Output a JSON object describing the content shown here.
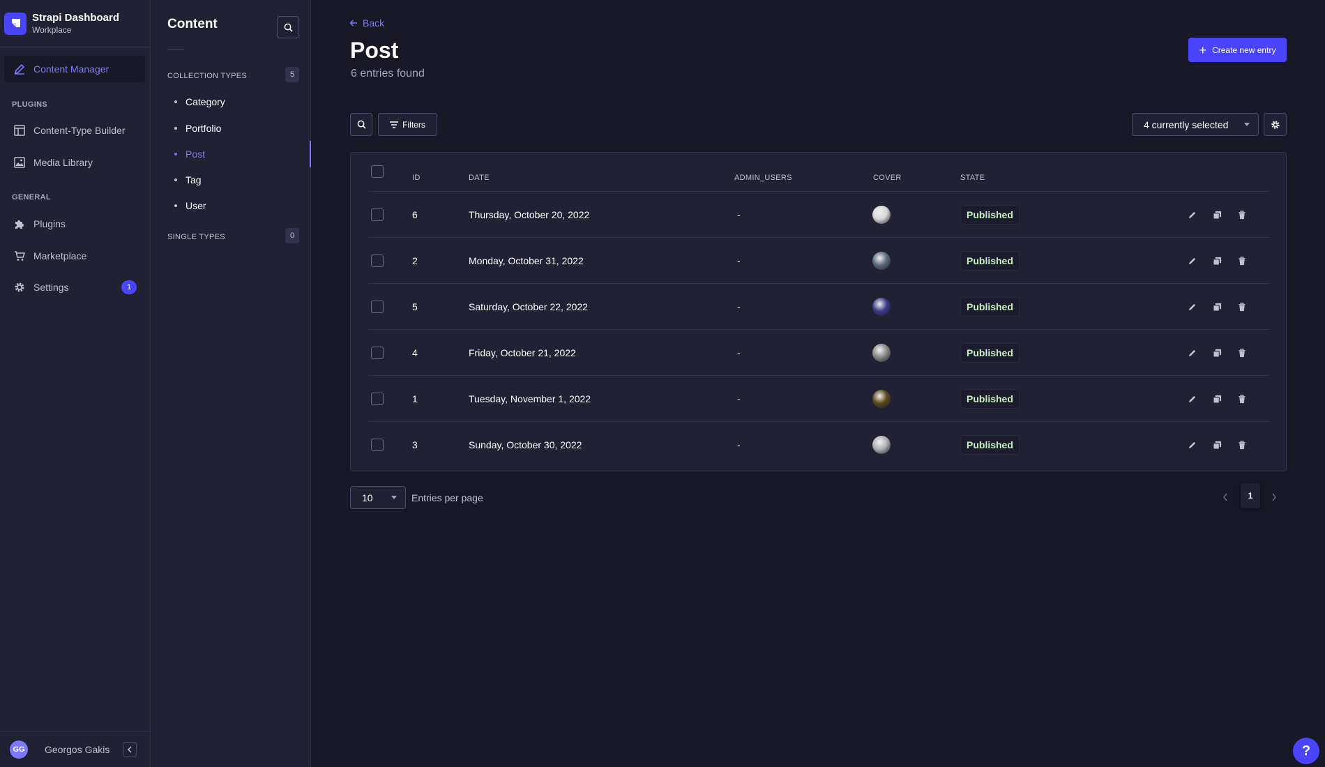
{
  "brand": {
    "title": "Strapi Dashboard",
    "subtitle": "Workplace"
  },
  "mainnav": {
    "content_manager": "Content Manager",
    "plugins_section": "PLUGINS",
    "content_type_builder": "Content-Type Builder",
    "media_library": "Media Library",
    "general_section": "GENERAL",
    "plugins": "Plugins",
    "marketplace": "Marketplace",
    "settings": "Settings",
    "settings_badge": "1"
  },
  "user": {
    "initials": "GG",
    "name": "Georgos Gakis"
  },
  "subnav": {
    "title": "Content",
    "collection_types_label": "COLLECTION TYPES",
    "collection_types_count": "5",
    "collection_types": [
      "Category",
      "Portfolio",
      "Post",
      "Tag",
      "User"
    ],
    "active_item": "Post",
    "single_types_label": "SINGLE TYPES",
    "single_types_count": "0"
  },
  "header": {
    "back_label": "Back",
    "title": "Post",
    "subtitle": "6 entries found",
    "create_label": "Create new entry"
  },
  "toolbar": {
    "filters_label": "Filters",
    "columns_selected": "4 currently selected"
  },
  "table": {
    "headers": {
      "id": "ID",
      "date": "DATE",
      "admin_users": "ADMIN_USERS",
      "cover": "COVER",
      "state": "STATE"
    },
    "rows": [
      {
        "id": "6",
        "date": "Thursday, October 20, 2022",
        "admin_users": "-",
        "state": "Published",
        "cover_color": "#d7d7d7"
      },
      {
        "id": "2",
        "date": "Monday, October 31, 2022",
        "admin_users": "-",
        "state": "Published",
        "cover_color": "#5b6b7a"
      },
      {
        "id": "5",
        "date": "Saturday, October 22, 2022",
        "admin_users": "-",
        "state": "Published",
        "cover_color": "#3b3b8a"
      },
      {
        "id": "4",
        "date": "Friday, October 21, 2022",
        "admin_users": "-",
        "state": "Published",
        "cover_color": "#8a8a8a"
      },
      {
        "id": "1",
        "date": "Tuesday, November 1, 2022",
        "admin_users": "-",
        "state": "Published",
        "cover_color": "#5a4a1a"
      },
      {
        "id": "3",
        "date": "Sunday, October 30, 2022",
        "admin_users": "-",
        "state": "Published",
        "cover_color": "#b0b0b0"
      }
    ]
  },
  "pagination": {
    "per_page": "10",
    "per_page_label": "Entries per page",
    "current_page": "1"
  },
  "help_label": "?",
  "colors": {
    "accent": "#4945ff",
    "accent_light": "#7b79ff",
    "background": "#181826",
    "surface": "#212134",
    "published": "#c6f0c2"
  }
}
